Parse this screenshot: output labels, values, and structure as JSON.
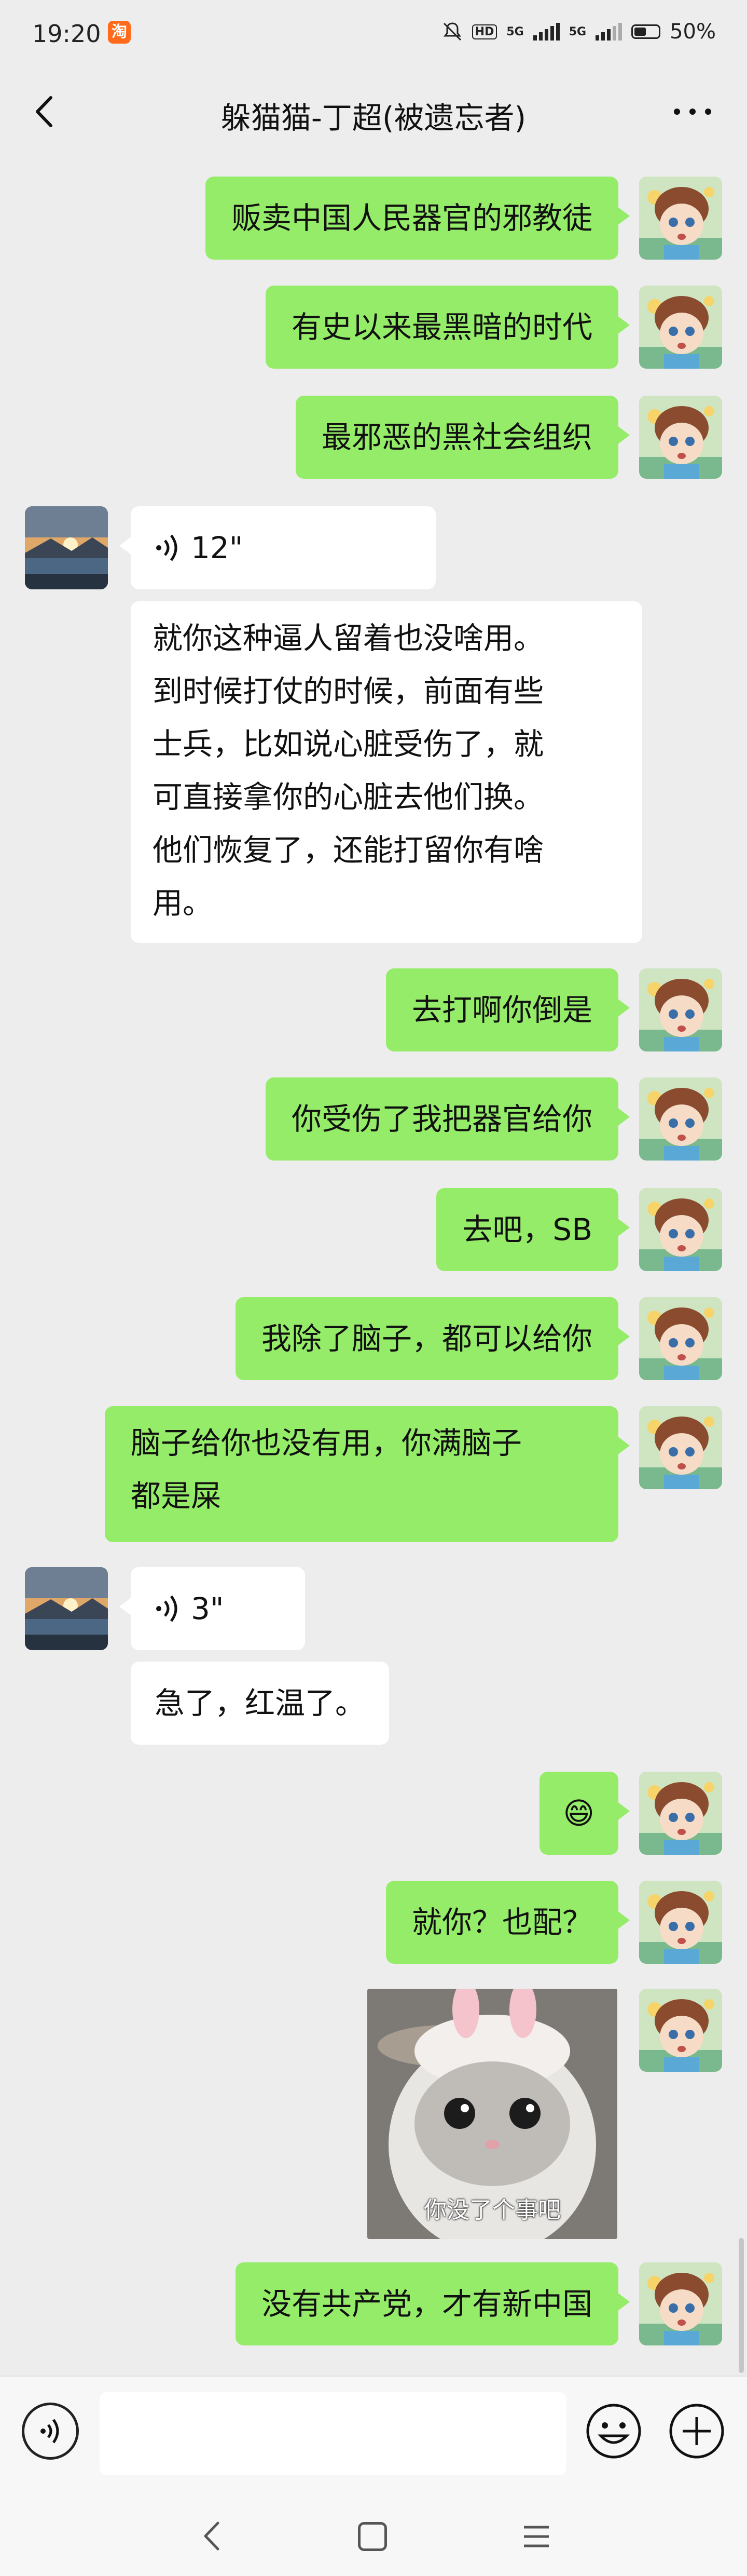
{
  "status": {
    "time": "19:20",
    "app_badge": "淘",
    "hd": "HD",
    "net1": "5G",
    "net2": "5G",
    "battery": "50%"
  },
  "header": {
    "title": "躲猫猫-丁超(被遗忘者)",
    "more": "···"
  },
  "messages": [
    {
      "from": "me",
      "text": "贩卖中国人民器官的邪教徒"
    },
    {
      "from": "me",
      "text": "有史以来最黑暗的时代"
    },
    {
      "from": "me",
      "text": "最邪恶的黑社会组织"
    },
    {
      "from": "other",
      "type": "voice",
      "duration": "12\""
    },
    {
      "from": "other",
      "text": "就你这种逼人留着也没啥用。到时候打仗的时候，前面有些士兵，比如说心脏受伤了，就可直接拿你的心脏去他们换。他们恢复了，还能打留你有啥用。"
    },
    {
      "from": "me",
      "text": "去打啊你倒是"
    },
    {
      "from": "me",
      "text": "你受伤了我把器官给你"
    },
    {
      "from": "me",
      "text": "去吧，SB"
    },
    {
      "from": "me",
      "text": "我除了脑子，都可以给你"
    },
    {
      "from": "me",
      "text": "脑子给你也没有用，你满脑子都是屎"
    },
    {
      "from": "other",
      "type": "voice",
      "duration": "3\""
    },
    {
      "from": "other",
      "text": "急了，红温了。"
    },
    {
      "from": "me",
      "text": "😄"
    },
    {
      "from": "me",
      "text": "就你？也配？"
    },
    {
      "from": "me",
      "type": "sticker",
      "caption": "你没了个事吧",
      "icon": "cat-sticker"
    },
    {
      "from": "me",
      "text": "没有共产党，才有新中国"
    }
  ],
  "lines": {
    "m4a": "就你这种逼人留着也没啥用。",
    "m4b": "到时候打仗的时候，前面有些",
    "m4c": "士兵，比如说心脏受伤了，就",
    "m4d": "可直接拿你的心脏去他们换。",
    "m4e": "他们恢复了，还能打留你有啥",
    "m4f": "用。",
    "m9a": "脑子给你也没有用，你满脑子",
    "m9b": "都是屎"
  },
  "colors": {
    "me_bubble": "#95ec69",
    "other_bubble": "#ffffff",
    "background": "#ededed"
  }
}
